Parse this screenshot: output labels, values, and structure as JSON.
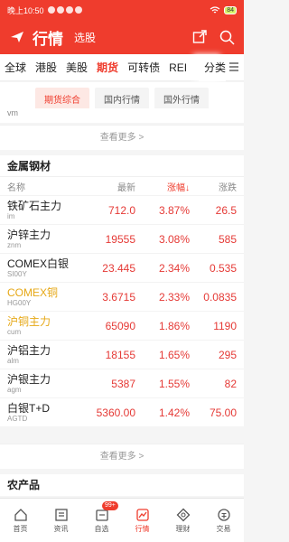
{
  "status_bar": {
    "time": "晚上10:50",
    "battery": "84"
  },
  "header": {
    "title": "行情",
    "subtitle": "选股"
  },
  "market_tabs": [
    "全球",
    "港股",
    "美股",
    "期货",
    "可转债",
    "REI"
  ],
  "market_tabs_extra": "分类",
  "sub_tabs": [
    "期货综合",
    "国内行情",
    "国外行情"
  ],
  "prev_section_tail": "vm",
  "see_more": "查看更多 >",
  "section_metals": {
    "title": "金属钢材",
    "columns": {
      "name": "名称",
      "price": "最新",
      "pct": "涨幅↓",
      "chg": "涨跌"
    },
    "rows": [
      {
        "name": "铁矿石主力",
        "code": "im",
        "price": "712.0",
        "pct": "3.87%",
        "chg": "26.5"
      },
      {
        "name": "沪锌主力",
        "code": "znm",
        "price": "19555",
        "pct": "3.08%",
        "chg": "585"
      },
      {
        "name": "COMEX白银",
        "code": "SI00Y",
        "price": "23.445",
        "pct": "2.34%",
        "chg": "0.535"
      },
      {
        "name": "COMEX铜",
        "code": "HG00Y",
        "price": "3.6715",
        "pct": "2.33%",
        "chg": "0.0835"
      },
      {
        "name": "沪铜主力",
        "code": "cum",
        "price": "65090",
        "pct": "1.86%",
        "chg": "1190"
      },
      {
        "name": "沪铝主力",
        "code": "alm",
        "price": "18155",
        "pct": "1.65%",
        "chg": "295"
      },
      {
        "name": "沪银主力",
        "code": "agm",
        "price": "5387",
        "pct": "1.55%",
        "chg": "82"
      },
      {
        "name": "白银T+D",
        "code": "AGTD",
        "price": "5360.00",
        "pct": "1.42%",
        "chg": "75.00"
      }
    ]
  },
  "section_agri": {
    "title": "农产品"
  },
  "bottom_nav": [
    {
      "label": "首页",
      "icon": "home-icon"
    },
    {
      "label": "资讯",
      "icon": "news-icon"
    },
    {
      "label": "自选",
      "icon": "watchlist-icon",
      "badge": "99+"
    },
    {
      "label": "行情",
      "icon": "market-icon"
    },
    {
      "label": "理财",
      "icon": "wealth-icon"
    },
    {
      "label": "交易",
      "icon": "trade-icon"
    }
  ],
  "colors": {
    "brand": "#ef3c2d",
    "up": "#e53935",
    "highlight": "#e6a817"
  }
}
